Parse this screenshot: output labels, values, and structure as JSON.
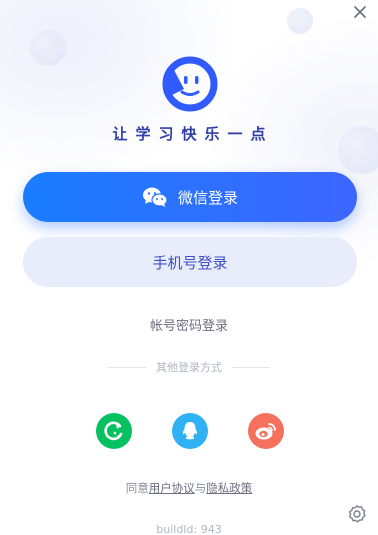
{
  "header": {
    "close_icon": "close-icon"
  },
  "brand": {
    "logo_icon": "smile-face-logo",
    "slogan": "让学习快乐一点",
    "accent": "#2f5bff"
  },
  "login": {
    "wechat_label": "微信登录",
    "wechat_icon": "wechat-icon",
    "phone_label": "手机号登录",
    "account_label": "帐号密码登录"
  },
  "other_login": {
    "title": "其他登录方式",
    "options": [
      {
        "name": "refresh-circle",
        "color": "#07c160"
      },
      {
        "name": "qq",
        "color": "#2fb1f3"
      },
      {
        "name": "weibo",
        "color": "#f6705e"
      }
    ]
  },
  "agreement": {
    "prefix": "同意",
    "user_agreement": "用户协议",
    "and": "与",
    "privacy_policy": "隐私政策"
  },
  "footer": {
    "build": "buildId: 943",
    "settings_icon": "settings-icon"
  }
}
